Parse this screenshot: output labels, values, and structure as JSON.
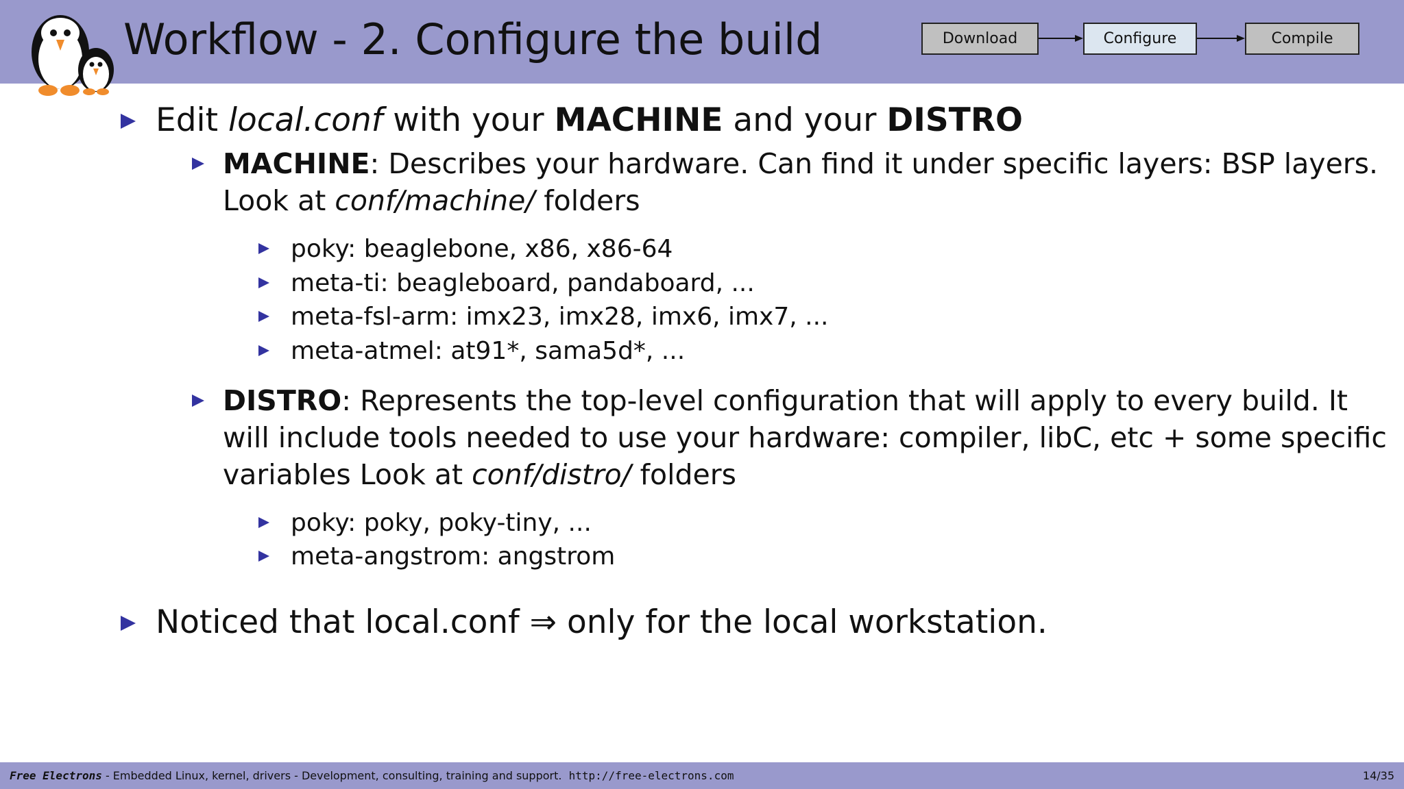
{
  "header": {
    "title": "Workflow - 2.  Configure the build",
    "workflow_steps": [
      {
        "label": "Download",
        "active": false
      },
      {
        "label": "Configure",
        "active": true
      },
      {
        "label": "Compile",
        "active": false
      }
    ]
  },
  "colors": {
    "header_bar": "#9999cc",
    "bullet": "#3333a0",
    "step_inactive": "#c0c0c0",
    "step_active": "#dce6f0"
  },
  "content": {
    "item1": {
      "prefix": "Edit ",
      "file": "local.conf",
      "mid1": " with your ",
      "kw1": "MACHINE",
      "mid2": " and your ",
      "kw2": "DISTRO",
      "machine": {
        "kw": "MACHINE",
        "line1": ": Describes your hardware.  Can find it under specific layers: BSP layers.",
        "line2_prefix": "Look at ",
        "line2_path": "conf/machine/",
        "line2_suffix": " folders",
        "examples": [
          "poky:  beaglebone, x86, x86-64",
          "meta-ti:  beagleboard, pandaboard, ...",
          "meta-fsl-arm:  imx23, imx28, imx6, imx7, ...",
          "meta-atmel:  at91*, sama5d*, ..."
        ]
      },
      "distro": {
        "kw": "DISTRO",
        "line1": ": Represents the top-level configuration that will apply to every build.  It",
        "line2": "will include tools needed to use your hardware: compiler, libC, etc + some specific",
        "line3_prefix": "variables Look at ",
        "line3_path": "conf/distro/",
        "line3_suffix": " folders",
        "examples": [
          "poky:  poky, poky-tiny, ...",
          "meta-angstrom:  angstrom"
        ]
      }
    },
    "item2": "Noticed that local.conf ⇒ only for the local workstation."
  },
  "footer": {
    "brand": "Free Electrons",
    "tagline": " - Embedded Linux, kernel, drivers - Development, consulting, training and support.  ",
    "url": "http://free-electrons.com",
    "page": "14/35"
  }
}
